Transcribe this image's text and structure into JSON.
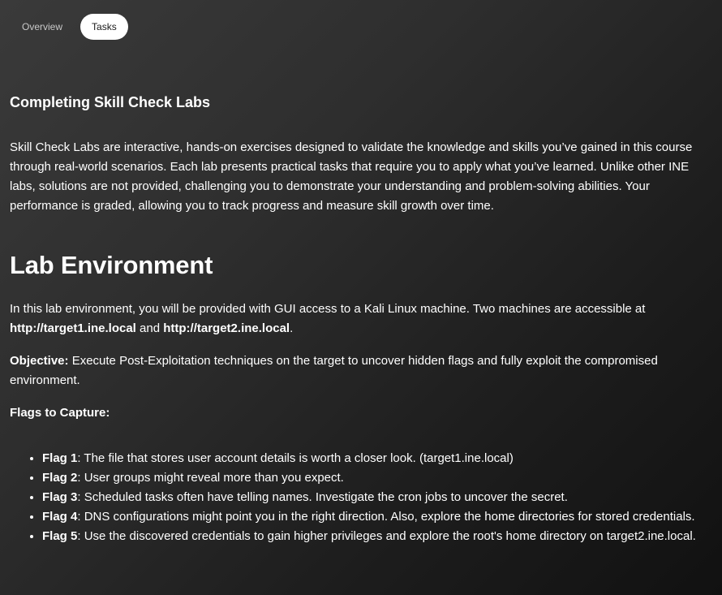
{
  "tabs": [
    {
      "label": "Overview",
      "active": false
    },
    {
      "label": "Tasks",
      "active": true
    }
  ],
  "section": {
    "title": "Completing Skill Check Labs",
    "intro": "Skill Check Labs are interactive, hands-on exercises designed to validate the knowledge and skills you’ve gained in this course through real-world scenarios. Each lab presents practical tasks that require you to apply what you’ve learned. Unlike other INE labs, solutions are not provided, challenging you to demonstrate your understanding and problem-solving abilities. Your performance is graded, allowing you to track progress and measure skill growth over time."
  },
  "lab": {
    "heading": "Lab Environment",
    "env_text": "In this lab environment, you will be provided with GUI access to a Kali Linux machine. Two machines are accessible at",
    "target1": "http://target1.ine.local",
    "and_text": " and ",
    "target2": "http://target2.ine.local",
    "period": ".",
    "objective_label": "Objective:",
    "objective_text": " Execute Post-Exploitation techniques on the target to uncover hidden flags and fully exploit the compromised environment.",
    "flags_title": "Flags to Capture:",
    "flags": [
      {
        "label": "Flag 1",
        "text": ": The file that stores user account details is worth a closer look. (target1.ine.local)"
      },
      {
        "label": "Flag 2",
        "text": ": User groups might reveal more than you expect."
      },
      {
        "label": "Flag 3",
        "text": ": Scheduled tasks often have telling names. Investigate the cron jobs to uncover the secret."
      },
      {
        "label": "Flag 4",
        "text": ": DNS configurations might point you in the right direction. Also, explore the home directories for stored credentials."
      },
      {
        "label": "Flag 5",
        "text": ": Use the discovered credentials to gain higher privileges and explore the root's home directory on target2.ine.local."
      }
    ]
  },
  "colors": {
    "text": "#ffffff",
    "tab_inactive": "#c9c9c9",
    "tab_active_bg": "#ffffff",
    "tab_active_text": "#1a1a1a"
  }
}
